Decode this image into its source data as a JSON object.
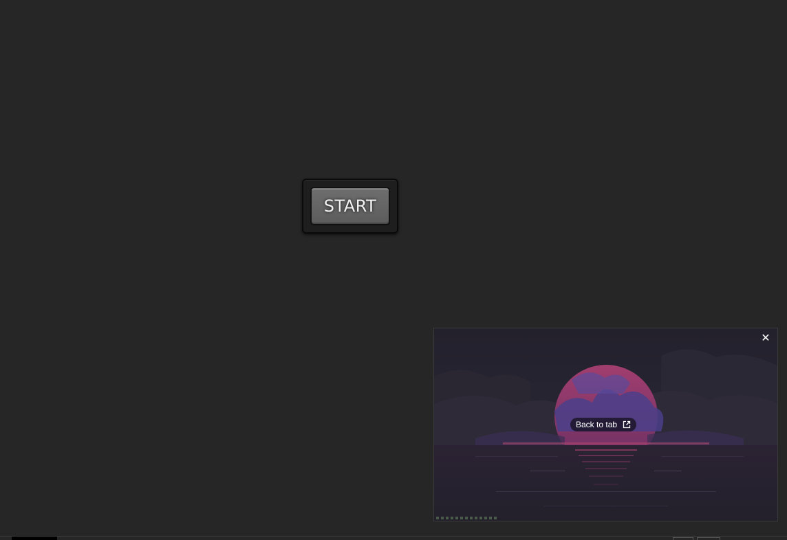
{
  "start": {
    "label": "START"
  },
  "pip": {
    "back_label": "Back to tab",
    "close_glyph": "✕",
    "icons": {
      "close": "close-icon",
      "open_external": "open-external-icon"
    }
  },
  "colors": {
    "background": "#262626",
    "button_face": "#666666",
    "pip_sun": "#8a3a6e",
    "pip_sky": "#24222f"
  }
}
